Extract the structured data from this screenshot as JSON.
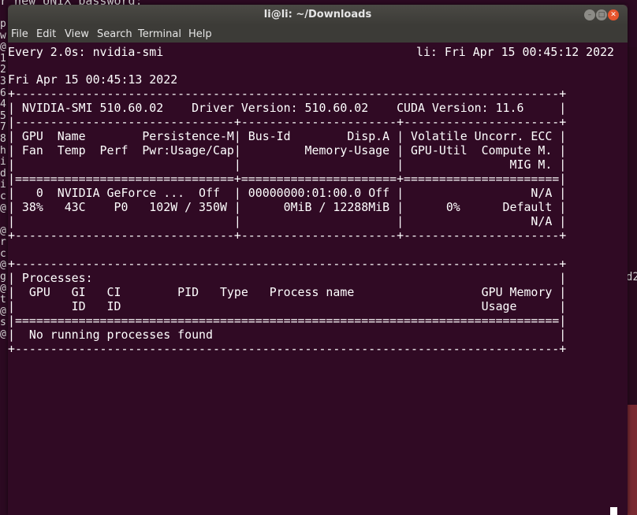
{
  "window": {
    "title": "li@li: ~/Downloads",
    "menu": [
      "File",
      "Edit",
      "View",
      "Search",
      "Terminal",
      "Help"
    ]
  },
  "background_terminal": {
    "top_line": "r new UNIX password:",
    "left_column": "p\nw\n@\n1\n2\n3\n6\n4\n5\n7\n8\nh\ni\nd\ni\nc\n@\n\n@\nr\nc\n@\ng\n@\nt\n@\ns\n@",
    "right_fragment": "d2"
  },
  "terminal": {
    "watch_header_left": "Every 2.0s: nvidia-smi",
    "watch_header_right": "li: Fri Apr 15 00:45:12 2022",
    "date_line": "Fri Apr 15 00:45:13 2022",
    "smi_lines": [
      "+-----------------------------------------------------------------------------+",
      "| NVIDIA-SMI 510.60.02    Driver Version: 510.60.02    CUDA Version: 11.6     |",
      "|-------------------------------+----------------------+----------------------+",
      "| GPU  Name        Persistence-M| Bus-Id        Disp.A | Volatile Uncorr. ECC |",
      "| Fan  Temp  Perf  Pwr:Usage/Cap|         Memory-Usage | GPU-Util  Compute M. |",
      "|                               |                      |               MIG M. |",
      "|===============================+======================+======================|",
      "|   0  NVIDIA GeForce ...  Off  | 00000000:01:00.0 Off |                  N/A |",
      "| 38%   43C    P0   102W / 350W |      0MiB / 12288MiB |      0%      Default |",
      "|                               |                      |                  N/A |",
      "+-------------------------------+----------------------+----------------------+",
      "",
      "+-----------------------------------------------------------------------------+",
      "| Processes:                                                                  |",
      "|  GPU   GI   CI        PID   Type   Process name                  GPU Memory |",
      "|        ID   ID                                                   Usage      |",
      "|=============================================================================|",
      "|  No running processes found                                                 |",
      "+-----------------------------------------------------------------------------+"
    ]
  }
}
